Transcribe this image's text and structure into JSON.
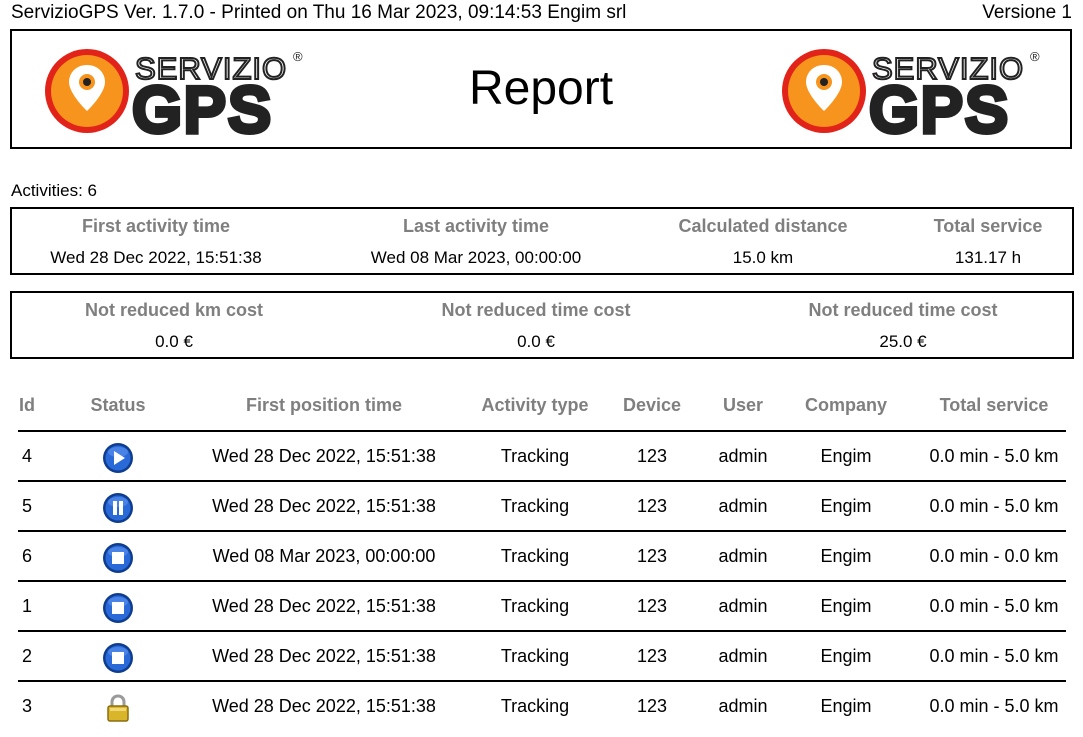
{
  "header": {
    "print_line": "ServizioGPS Ver. 1.7.0 - Printed on Thu 16 Mar 2023, 09:14:53 Engim srl",
    "version": "Versione 1",
    "title": "Report",
    "logo_text_top": "SERVIZIO",
    "logo_text_bottom": "GPS",
    "logo_registered": "®"
  },
  "activities": {
    "label": "Activities: 6"
  },
  "summary1": [
    {
      "label": "First activity time",
      "value": "Wed 28 Dec 2022, 15:51:38"
    },
    {
      "label": "Last activity time",
      "value": "Wed 08 Mar 2023, 00:00:00"
    },
    {
      "label": "Calculated distance",
      "value": "15.0 km"
    },
    {
      "label": "Total service",
      "value": "131.17 h"
    }
  ],
  "summary2": [
    {
      "label": "Not reduced km cost",
      "value": "0.0 €"
    },
    {
      "label": "Not reduced time cost",
      "value": "0.0 €"
    },
    {
      "label": "Not reduced time cost",
      "value": "25.0 €"
    }
  ],
  "table": {
    "columns": [
      "Id",
      "Status",
      "First position time",
      "Activity type",
      "Device",
      "User",
      "Company",
      "Total service"
    ],
    "rows": [
      {
        "id": "4",
        "status": "play-icon",
        "time": "Wed 28 Dec 2022, 15:51:38",
        "type": "Tracking",
        "device": "123",
        "user": "admin",
        "company": "Engim",
        "service": "0.0 min - 5.0 km"
      },
      {
        "id": "5",
        "status": "pause-icon",
        "time": "Wed 28 Dec 2022, 15:51:38",
        "type": "Tracking",
        "device": "123",
        "user": "admin",
        "company": "Engim",
        "service": "0.0 min - 5.0 km"
      },
      {
        "id": "6",
        "status": "stop-icon",
        "time": "Wed 08 Mar 2023, 00:00:00",
        "type": "Tracking",
        "device": "123",
        "user": "admin",
        "company": "Engim",
        "service": "0.0 min - 0.0 km"
      },
      {
        "id": "1",
        "status": "stop-icon",
        "time": "Wed 28 Dec 2022, 15:51:38",
        "type": "Tracking",
        "device": "123",
        "user": "admin",
        "company": "Engim",
        "service": "0.0 min - 5.0 km"
      },
      {
        "id": "2",
        "status": "stop-icon",
        "time": "Wed 28 Dec 2022, 15:51:38",
        "type": "Tracking",
        "device": "123",
        "user": "admin",
        "company": "Engim",
        "service": "0.0 min - 5.0 km"
      },
      {
        "id": "3",
        "status": "lock-icon",
        "time": "Wed 28 Dec 2022, 15:51:38",
        "type": "Tracking",
        "device": "123",
        "user": "admin",
        "company": "Engim",
        "service": "0.0 min - 5.0 km"
      }
    ]
  },
  "colors": {
    "logo_orange": "#f7941d",
    "logo_red": "#e2231a",
    "header_gray": "#7f7f7f",
    "status_blue": "#1a56c4",
    "lock_gold": "#d9b52a"
  }
}
